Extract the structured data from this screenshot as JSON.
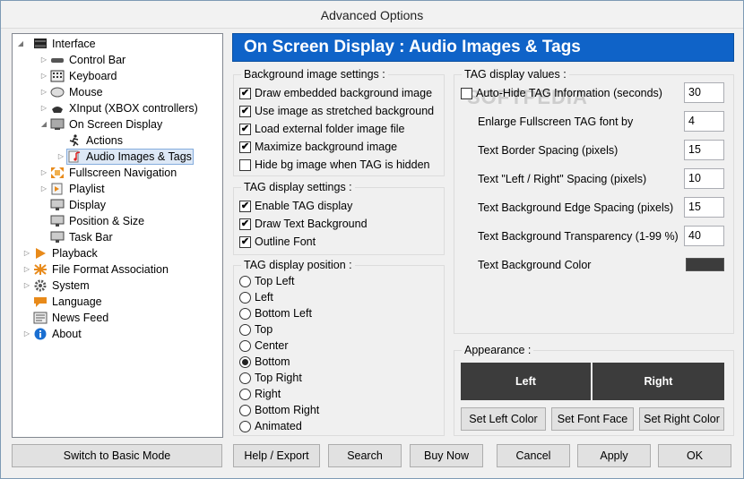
{
  "window": {
    "title": "Advanced Options"
  },
  "watermark": "SOFTPEDIA",
  "tree": [
    {
      "label": "Interface",
      "icon": "interface-icon",
      "expander": "◢"
    },
    {
      "label": "Control Bar",
      "icon": "control-bar-icon",
      "expander": "▷"
    },
    {
      "label": "Keyboard",
      "icon": "keyboard-icon",
      "expander": "▷"
    },
    {
      "label": "Mouse",
      "icon": "mouse-icon",
      "expander": "▷"
    },
    {
      "label": "XInput (XBOX controllers)",
      "icon": "xinput-icon",
      "expander": "▷"
    },
    {
      "label": "On Screen Display",
      "icon": "osd-icon",
      "expander": "◢"
    },
    {
      "label": "Actions",
      "icon": "actions-icon",
      "expander": ""
    },
    {
      "label": "Audio Images & Tags",
      "icon": "audio-images-icon",
      "expander": "▷"
    },
    {
      "label": "Fullscreen Navigation",
      "icon": "fullscreen-icon",
      "expander": "▷"
    },
    {
      "label": "Playlist",
      "icon": "playlist-icon",
      "expander": "▷"
    },
    {
      "label": "Display",
      "icon": "display-icon",
      "expander": ""
    },
    {
      "label": "Position & Size",
      "icon": "position-icon",
      "expander": ""
    },
    {
      "label": "Task Bar",
      "icon": "taskbar-icon",
      "expander": ""
    },
    {
      "label": "Playback",
      "icon": "playback-icon",
      "expander": "▷"
    },
    {
      "label": "File Format Association",
      "icon": "file-format-icon",
      "expander": "▷"
    },
    {
      "label": "System",
      "icon": "system-icon",
      "expander": "▷"
    },
    {
      "label": "Language",
      "icon": "language-icon",
      "expander": ""
    },
    {
      "label": "News Feed",
      "icon": "news-icon",
      "expander": ""
    },
    {
      "label": "About",
      "icon": "about-icon",
      "expander": "▷"
    }
  ],
  "header": {
    "title": "On Screen Display : Audio Images & Tags"
  },
  "bg_settings": {
    "title": "Background image settings :",
    "items": [
      {
        "label": "Draw embedded background image",
        "checked": "✔"
      },
      {
        "label": "Use image as stretched background",
        "checked": "✔"
      },
      {
        "label": "Load external folder image file",
        "checked": "✔"
      },
      {
        "label": "Maximize background image",
        "checked": "✔"
      },
      {
        "label": "Hide bg image when TAG is hidden",
        "checked": ""
      }
    ]
  },
  "tag_settings": {
    "title": "TAG display settings :",
    "items": [
      {
        "label": "Enable TAG display",
        "checked": "✔"
      },
      {
        "label": "Draw Text Background",
        "checked": "✔"
      },
      {
        "label": "Outline Font",
        "checked": "✔"
      }
    ]
  },
  "tag_position": {
    "title": "TAG display position :",
    "selected": "Bottom",
    "options": [
      "Top Left",
      "Left",
      "Bottom Left",
      "Top",
      "Center",
      "Bottom",
      "Top Right",
      "Right",
      "Bottom Right",
      "Animated"
    ]
  },
  "tag_values": {
    "title": "TAG display values :",
    "autohide": {
      "label": "Auto-Hide TAG Information (seconds)",
      "checked": "",
      "value": "30"
    },
    "rows": [
      {
        "label": "Enlarge Fullscreen TAG font by",
        "value": "4"
      },
      {
        "label": "Text Border Spacing (pixels)",
        "value": "15"
      },
      {
        "label": "Text \"Left / Right\" Spacing (pixels)",
        "value": "10"
      },
      {
        "label": "Text Background Edge Spacing (pixels)",
        "value": "15"
      },
      {
        "label": "Text Background Transparency (1-99 %)",
        "value": "40"
      }
    ],
    "color_label": "Text Background Color",
    "color": "#3c3c3c"
  },
  "appearance": {
    "title": "Appearance :",
    "left": "Left",
    "right": "Right",
    "buttons": [
      "Set Left Color",
      "Set Font Face",
      "Set Right Color"
    ]
  },
  "footer": {
    "basic_mode": "Switch to Basic Mode",
    "help": "Help / Export",
    "search": "Search",
    "buy": "Buy Now",
    "cancel": "Cancel",
    "apply": "Apply",
    "ok": "OK"
  },
  "colors": {
    "header_bg": "#0f63c8",
    "panel_dark": "#3c3c3c",
    "selection": "#dde8f6"
  }
}
